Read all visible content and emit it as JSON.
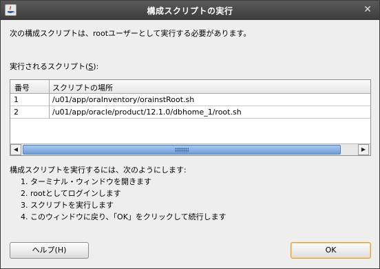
{
  "window": {
    "title": "構成スクリプトの実行",
    "close_glyph": "✕"
  },
  "intro_text": "次の構成スクリプトは、rootユーザーとして実行する必要があります。",
  "list_label": {
    "text": "実行されるスクリプト(",
    "mnemonic": "S",
    "suffix": "):"
  },
  "table": {
    "headers": [
      "番号",
      "スクリプトの場所"
    ],
    "rows": [
      {
        "number": "1",
        "path": "/u01/app/oraInventory/orainstRoot.sh"
      },
      {
        "number": "2",
        "path": "/u01/app/oracle/product/12.1.0/dbhome_1/root.sh"
      }
    ]
  },
  "instructions": {
    "heading": "構成スクリプトを実行するには、次のようにします:",
    "steps": [
      "1. ターミナル・ウィンドウを開きます",
      "2. rootとしてログインします",
      "3. スクリプトを実行します",
      "4. このウィンドウに戻り、「OK」をクリックして続行します"
    ]
  },
  "buttons": {
    "help": "ヘルプ(H)",
    "ok": "OK"
  }
}
